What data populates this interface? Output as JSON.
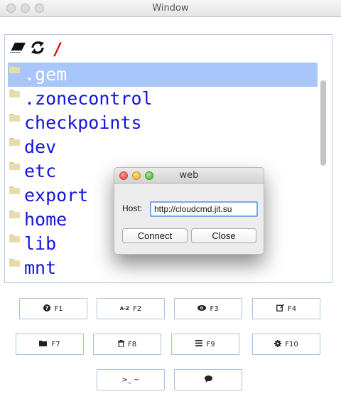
{
  "window": {
    "title": "Window"
  },
  "toolbar": {
    "root_path": "/"
  },
  "files": [
    {
      "name": ".gem",
      "selected": true
    },
    {
      "name": ".zonecontrol",
      "selected": false
    },
    {
      "name": "checkpoints",
      "selected": false
    },
    {
      "name": "dev",
      "selected": false
    },
    {
      "name": "etc",
      "selected": false
    },
    {
      "name": "export",
      "selected": false
    },
    {
      "name": "home",
      "selected": false
    },
    {
      "name": "lib",
      "selected": false
    },
    {
      "name": "mnt",
      "selected": false
    }
  ],
  "fkeys": {
    "f1": "F1",
    "f2": "F2",
    "f3": "F3",
    "f4": "F4",
    "f7": "F7",
    "f8": "F8",
    "f9": "F9",
    "f10": "F10",
    "console": ">_ ~",
    "sort_icon_text": "A-Z"
  },
  "dialog": {
    "title": "web",
    "host_label": "Host:",
    "host_value": "http://cloudcmd.jit.su",
    "connect_label": "Connect",
    "close_label": "Close"
  },
  "colors": {
    "selection": "#a9c6fb",
    "file_text": "#1515d8",
    "root_slash": "#e01010",
    "button_border": "#a9c4e2",
    "mac_close": "#ec5f56",
    "mac_minimize": "#f4bc40",
    "mac_zoom": "#5fc84a"
  }
}
